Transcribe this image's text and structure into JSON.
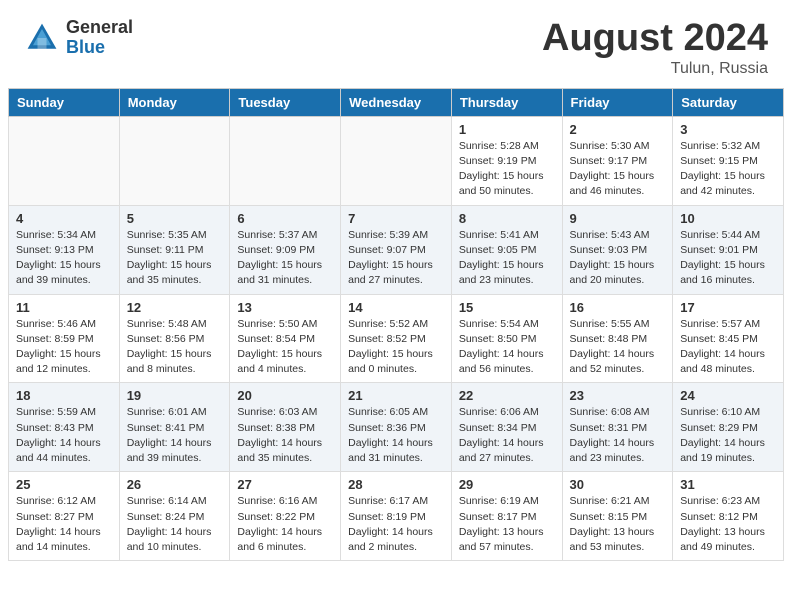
{
  "header": {
    "logo_general": "General",
    "logo_blue": "Blue",
    "month_title": "August 2024",
    "location": "Tulun, Russia"
  },
  "days_of_week": [
    "Sunday",
    "Monday",
    "Tuesday",
    "Wednesday",
    "Thursday",
    "Friday",
    "Saturday"
  ],
  "weeks": [
    [
      {
        "day": "",
        "info": ""
      },
      {
        "day": "",
        "info": ""
      },
      {
        "day": "",
        "info": ""
      },
      {
        "day": "",
        "info": ""
      },
      {
        "day": "1",
        "info": "Sunrise: 5:28 AM\nSunset: 9:19 PM\nDaylight: 15 hours\nand 50 minutes."
      },
      {
        "day": "2",
        "info": "Sunrise: 5:30 AM\nSunset: 9:17 PM\nDaylight: 15 hours\nand 46 minutes."
      },
      {
        "day": "3",
        "info": "Sunrise: 5:32 AM\nSunset: 9:15 PM\nDaylight: 15 hours\nand 42 minutes."
      }
    ],
    [
      {
        "day": "4",
        "info": "Sunrise: 5:34 AM\nSunset: 9:13 PM\nDaylight: 15 hours\nand 39 minutes."
      },
      {
        "day": "5",
        "info": "Sunrise: 5:35 AM\nSunset: 9:11 PM\nDaylight: 15 hours\nand 35 minutes."
      },
      {
        "day": "6",
        "info": "Sunrise: 5:37 AM\nSunset: 9:09 PM\nDaylight: 15 hours\nand 31 minutes."
      },
      {
        "day": "7",
        "info": "Sunrise: 5:39 AM\nSunset: 9:07 PM\nDaylight: 15 hours\nand 27 minutes."
      },
      {
        "day": "8",
        "info": "Sunrise: 5:41 AM\nSunset: 9:05 PM\nDaylight: 15 hours\nand 23 minutes."
      },
      {
        "day": "9",
        "info": "Sunrise: 5:43 AM\nSunset: 9:03 PM\nDaylight: 15 hours\nand 20 minutes."
      },
      {
        "day": "10",
        "info": "Sunrise: 5:44 AM\nSunset: 9:01 PM\nDaylight: 15 hours\nand 16 minutes."
      }
    ],
    [
      {
        "day": "11",
        "info": "Sunrise: 5:46 AM\nSunset: 8:59 PM\nDaylight: 15 hours\nand 12 minutes."
      },
      {
        "day": "12",
        "info": "Sunrise: 5:48 AM\nSunset: 8:56 PM\nDaylight: 15 hours\nand 8 minutes."
      },
      {
        "day": "13",
        "info": "Sunrise: 5:50 AM\nSunset: 8:54 PM\nDaylight: 15 hours\nand 4 minutes."
      },
      {
        "day": "14",
        "info": "Sunrise: 5:52 AM\nSunset: 8:52 PM\nDaylight: 15 hours\nand 0 minutes."
      },
      {
        "day": "15",
        "info": "Sunrise: 5:54 AM\nSunset: 8:50 PM\nDaylight: 14 hours\nand 56 minutes."
      },
      {
        "day": "16",
        "info": "Sunrise: 5:55 AM\nSunset: 8:48 PM\nDaylight: 14 hours\nand 52 minutes."
      },
      {
        "day": "17",
        "info": "Sunrise: 5:57 AM\nSunset: 8:45 PM\nDaylight: 14 hours\nand 48 minutes."
      }
    ],
    [
      {
        "day": "18",
        "info": "Sunrise: 5:59 AM\nSunset: 8:43 PM\nDaylight: 14 hours\nand 44 minutes."
      },
      {
        "day": "19",
        "info": "Sunrise: 6:01 AM\nSunset: 8:41 PM\nDaylight: 14 hours\nand 39 minutes."
      },
      {
        "day": "20",
        "info": "Sunrise: 6:03 AM\nSunset: 8:38 PM\nDaylight: 14 hours\nand 35 minutes."
      },
      {
        "day": "21",
        "info": "Sunrise: 6:05 AM\nSunset: 8:36 PM\nDaylight: 14 hours\nand 31 minutes."
      },
      {
        "day": "22",
        "info": "Sunrise: 6:06 AM\nSunset: 8:34 PM\nDaylight: 14 hours\nand 27 minutes."
      },
      {
        "day": "23",
        "info": "Sunrise: 6:08 AM\nSunset: 8:31 PM\nDaylight: 14 hours\nand 23 minutes."
      },
      {
        "day": "24",
        "info": "Sunrise: 6:10 AM\nSunset: 8:29 PM\nDaylight: 14 hours\nand 19 minutes."
      }
    ],
    [
      {
        "day": "25",
        "info": "Sunrise: 6:12 AM\nSunset: 8:27 PM\nDaylight: 14 hours\nand 14 minutes."
      },
      {
        "day": "26",
        "info": "Sunrise: 6:14 AM\nSunset: 8:24 PM\nDaylight: 14 hours\nand 10 minutes."
      },
      {
        "day": "27",
        "info": "Sunrise: 6:16 AM\nSunset: 8:22 PM\nDaylight: 14 hours\nand 6 minutes."
      },
      {
        "day": "28",
        "info": "Sunrise: 6:17 AM\nSunset: 8:19 PM\nDaylight: 14 hours\nand 2 minutes."
      },
      {
        "day": "29",
        "info": "Sunrise: 6:19 AM\nSunset: 8:17 PM\nDaylight: 13 hours\nand 57 minutes."
      },
      {
        "day": "30",
        "info": "Sunrise: 6:21 AM\nSunset: 8:15 PM\nDaylight: 13 hours\nand 53 minutes."
      },
      {
        "day": "31",
        "info": "Sunrise: 6:23 AM\nSunset: 8:12 PM\nDaylight: 13 hours\nand 49 minutes."
      }
    ]
  ]
}
